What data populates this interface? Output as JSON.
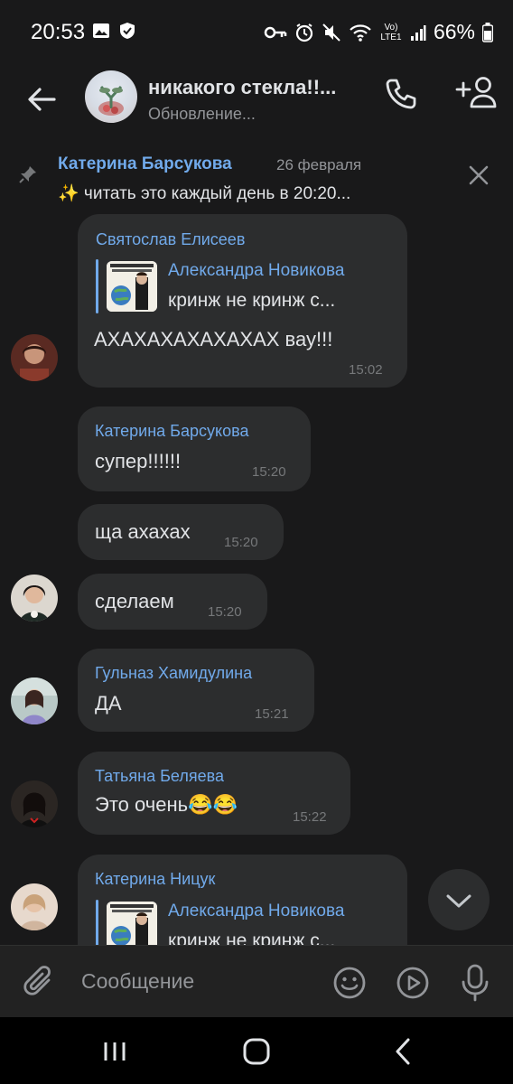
{
  "status_bar": {
    "time": "20:53",
    "battery": "66%",
    "network": "Vo) LTE1"
  },
  "header": {
    "title": "никакого стекла!!...",
    "subtitle": "Обновление..."
  },
  "pinned": {
    "author": "Катерина Барсукова",
    "date": "26 февраля",
    "text": "✨ читать это каждый день в 20:20..."
  },
  "messages": [
    {
      "sender": "Святослав Елисеев",
      "quote_author": "Александра Новикова",
      "quote_text": "кринж не кринж с...",
      "text": "АХАХАХАХАХАХАХ вау!!!",
      "time": "15:02"
    },
    {
      "sender": "Катерина Барсукова",
      "text": "супер!!!!!!",
      "time": "15:20"
    },
    {
      "text": "ща ахахах",
      "time": "15:20"
    },
    {
      "text": "сделаем",
      "time": "15:20"
    },
    {
      "sender": "Гульназ Хамидулина",
      "text": "ДА",
      "time": "15:21"
    },
    {
      "sender": "Татьяна Беляева",
      "text": "Это очень😂😂",
      "time": "15:22"
    },
    {
      "sender": "Катерина Ницук",
      "quote_author": "Александра Новикова",
      "quote_text": "кринж не кринж с..."
    }
  ],
  "composer": {
    "placeholder": "Сообщение"
  },
  "colors": {
    "background": "#19191a",
    "bubble": "#2c2d2e",
    "accent": "#71aaeb"
  }
}
